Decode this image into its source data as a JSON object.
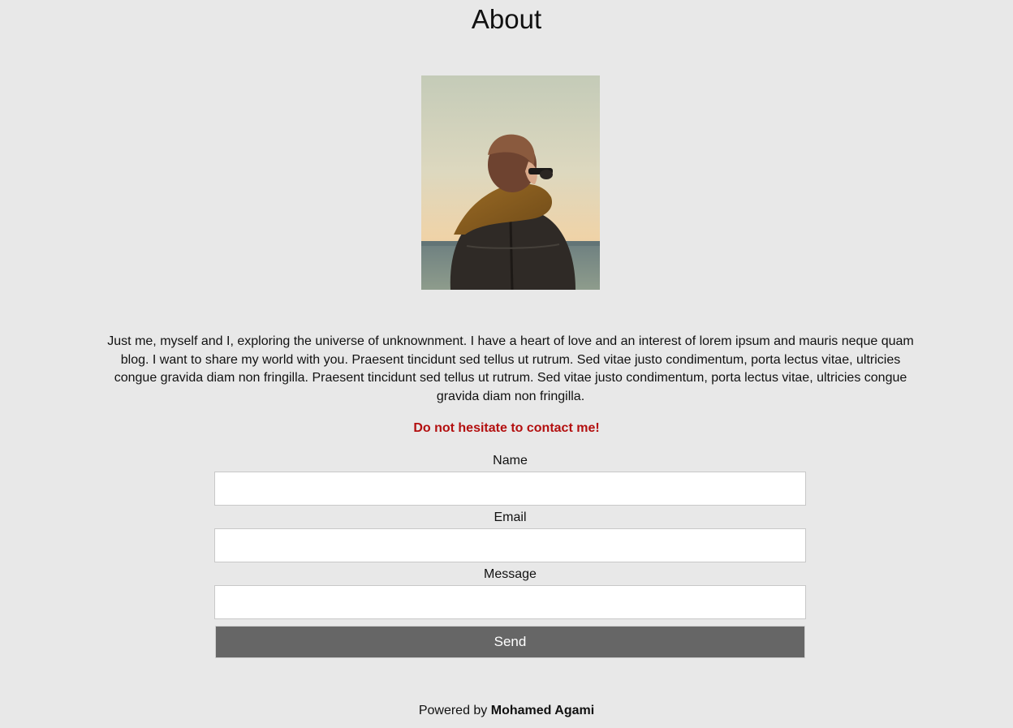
{
  "header": {
    "title": "About"
  },
  "profile": {
    "photo_alt": "person with scarf facing the sea"
  },
  "bio": {
    "text": "Just me, myself and I, exploring the universe of unknownment. I have a heart of love and an interest of lorem ipsum and mauris neque quam blog. I want to share my world with you. Praesent tincidunt sed tellus ut rutrum. Sed vitae justo condimentum, porta lectus vitae, ultricies congue gravida diam non fringilla. Praesent tincidunt sed tellus ut rutrum. Sed vitae justo condimentum, porta lectus vitae, ultricies congue gravida diam non fringilla."
  },
  "contact": {
    "cta": "Do not hesitate to contact me!",
    "cta_color": "#b30f0f",
    "fields": {
      "name_label": "Name",
      "name_value": "",
      "email_label": "Email",
      "email_value": "",
      "message_label": "Message",
      "message_value": ""
    },
    "send_label": "Send",
    "send_color": "#666666"
  },
  "footer": {
    "prefix": "Powered by",
    "author": "Mohamed Agami"
  }
}
